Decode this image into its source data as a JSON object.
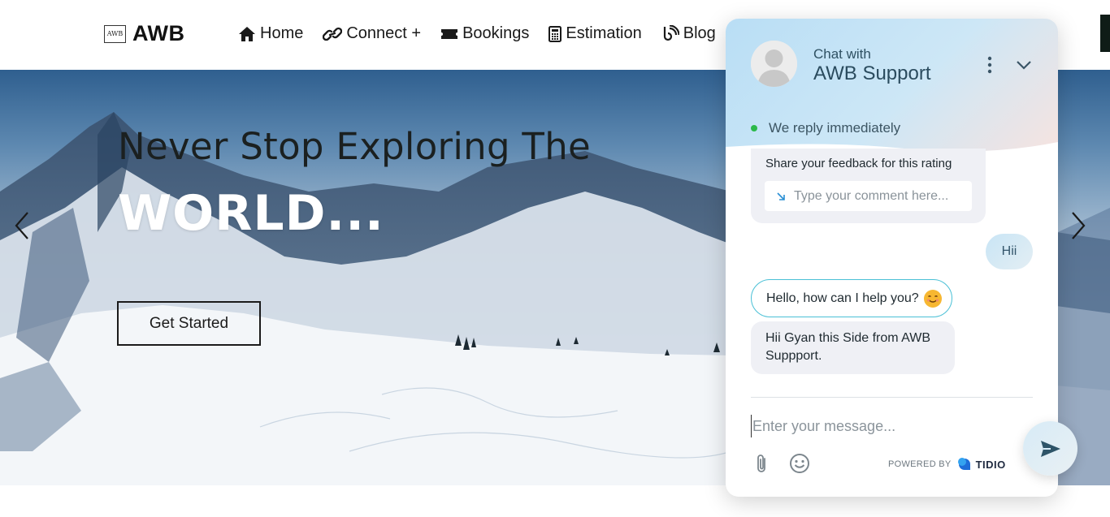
{
  "brand": {
    "logo_mark": "AWB",
    "name": "AWB"
  },
  "nav": {
    "items": [
      {
        "label": "Home",
        "icon": "home-icon"
      },
      {
        "label": "Connect +",
        "icon": "link-icon"
      },
      {
        "label": "Bookings",
        "icon": "ticket-icon"
      },
      {
        "label": "Estimation",
        "icon": "calculator-icon"
      },
      {
        "label": "Blog",
        "icon": "blog-icon"
      }
    ]
  },
  "hero": {
    "title": "Never Stop Exploring The",
    "headline": "WORLD...",
    "cta_label": "Get Started",
    "prev_icon": "chevron-left-icon",
    "next_icon": "chevron-right-icon"
  },
  "chat": {
    "header": {
      "prefix": "Chat with",
      "agent": "AWB Support",
      "status": "We reply immediately"
    },
    "feedback": {
      "label": "Share your feedback for this rating",
      "placeholder": "Type your comment here..."
    },
    "messages": [
      {
        "from": "user",
        "text": "Hii"
      },
      {
        "from": "bot",
        "text": "Hello, how can I help you?"
      },
      {
        "from": "bot",
        "text": "Hii Gyan this Side from AWB Suppport."
      }
    ],
    "input_placeholder": "Enter your message...",
    "powered_by": "POWERED BY",
    "powered_brand": "TIDIO"
  },
  "colors": {
    "accent": "#4ac0d6",
    "status_online": "#2bb94a",
    "header_gradient_start": "#b9def5",
    "header_gradient_end": "#f6e3e0"
  }
}
